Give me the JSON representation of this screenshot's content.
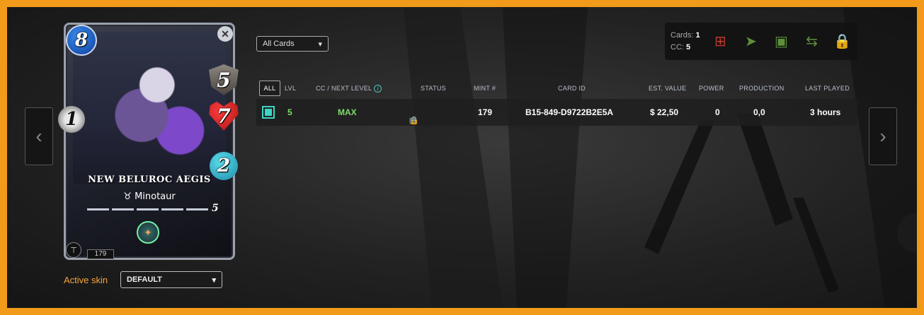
{
  "nav": {
    "prev_glyph": "‹",
    "next_glyph": "›"
  },
  "card": {
    "name": "NEW BELUROC AEGIS",
    "type": "Minotaur",
    "mana": "8",
    "attack": "1",
    "armor": "5",
    "health": "7",
    "speed": "2",
    "level": "5",
    "mint_badge": "179",
    "close_glyph": "✕",
    "edition_glyph": "⊤",
    "ability_glyph": "✦",
    "type_glyph": "♉"
  },
  "skin": {
    "label": "Active skin",
    "selected": "DEFAULT"
  },
  "filter": {
    "selected": "All Cards"
  },
  "actions": {
    "cards_label": "Cards:",
    "cards_value": "1",
    "cc_label": "CC:",
    "cc_value": "5",
    "icons": {
      "combine": "⊞",
      "send": "➤",
      "market": "▣",
      "transfer": "⇆",
      "lock": "🔒"
    }
  },
  "table": {
    "all_label": "ALL",
    "headers": [
      "LVL",
      "CC / NEXT LEVEL",
      "STATUS",
      "MINT #",
      "CARD ID",
      "EST. VALUE",
      "POWER",
      "PRODUCTION",
      "LAST PLAYED"
    ],
    "row": {
      "lvl": "5",
      "cc_next": "MAX",
      "status_icons": [
        "◷",
        "▣",
        "🔒",
        "⇆"
      ],
      "mint": "179",
      "card_id": "B15-849-D9722B2E5A",
      "est_value": "$ 22,50",
      "power": "0",
      "production": "0,0",
      "last_played": "3 hours"
    }
  },
  "colors": {
    "frame": "#f29a1a",
    "accent_teal": "#3ad6c4",
    "green": "#7ddc6a",
    "skin_label": "#f7a43c"
  }
}
